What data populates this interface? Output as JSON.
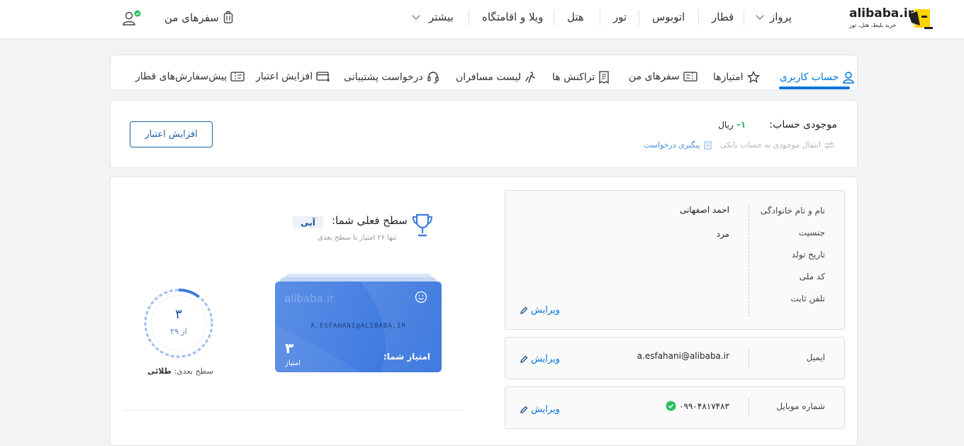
{
  "header": {
    "logo_text": "alibaba.ir",
    "logo_sub": "خرید بلیط، هتل، تور",
    "nav": [
      "پرواز",
      "قطار",
      "اتوبوس",
      "تور",
      "هتل",
      "ویلا و اقامتگاه",
      "بیشتر"
    ],
    "my_trips": "سفرهای من"
  },
  "tabs": [
    {
      "label": "حساب کاربری",
      "icon": "user-icon"
    },
    {
      "label": "امتیازها",
      "icon": "star-icon"
    },
    {
      "label": "سفرهای من",
      "icon": "ticket-icon"
    },
    {
      "label": "تراکنش ها",
      "icon": "receipt-icon"
    },
    {
      "label": "لیست مسافران",
      "icon": "passengers-icon"
    },
    {
      "label": "درخواست پشتیبانی",
      "icon": "headset-icon"
    },
    {
      "label": "افزایش اعتبار",
      "icon": "credit-card-icon"
    },
    {
      "label": "پیش‌سفارش‌های قطار",
      "icon": "train-ticket-icon"
    }
  ],
  "balance": {
    "label": "موجودی حساب:",
    "amount": "۱-",
    "currency": "ریال",
    "transfer": "انتقال موجودی به حساب بانکی",
    "track": "پیگیری درخواست",
    "increase_button": "افزایش اعتبار"
  },
  "profile": {
    "fields": [
      {
        "label": "نام و نام خانوادگی",
        "value": "احمد اصفهانی"
      },
      {
        "label": "جنسیت",
        "value": "مرد"
      },
      {
        "label": "تاریخ تولد",
        "value": ""
      },
      {
        "label": "کد ملی",
        "value": ""
      },
      {
        "label": "تلفن ثابت",
        "value": ""
      }
    ],
    "edit": "ویرایش",
    "email_label": "ایمیل",
    "email_value": "a.esfahani@alibaba.ir",
    "mobile_label": "شماره موبایل",
    "mobile_value": "۰۹۹۰۴۸۱۷۴۸۳"
  },
  "level": {
    "title": "سطح فعلی شما:",
    "badge": "آبی",
    "subtitle": "تنها ۲۶ امتیاز تا سطح بعدی",
    "card_logo": "alibaba.ir",
    "card_email": "A.ESFAHANI@ALIBABA.IR",
    "card_points_label": "امتیاز شما:",
    "card_points": "۳",
    "card_points_unit": "امتیاز",
    "ring_value": "۳",
    "ring_of": "از ۲۹",
    "ring_progress": 0.103,
    "next_label": "سطح بعدی:",
    "next_level": "طلائی"
  },
  "colors": {
    "accent": "#0077db",
    "green": "#2dbe60",
    "card_blue": "#3d7be0"
  }
}
